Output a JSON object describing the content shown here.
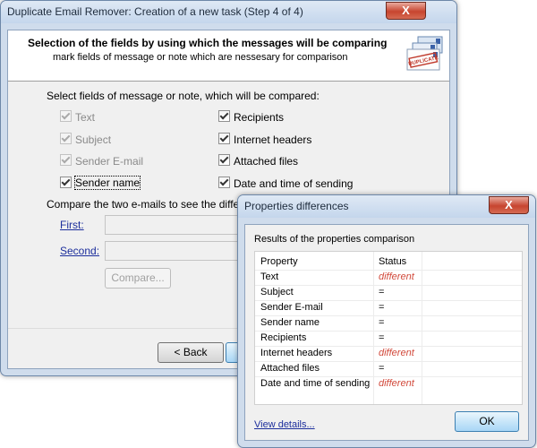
{
  "main_window": {
    "title": "Duplicate Email Remover: Creation of a new task (Step 4 of 4)",
    "close_glyph": "X",
    "header": {
      "title": "Selection of the fields by using which the messages will be comparing",
      "subtitle": "mark fields of message or note which are nessesary for comparison",
      "logo_text": "DUPLICATE",
      "logo_icon": "duplicate-envelopes-icon"
    },
    "fields_caption": "Select fields of message or note, which will be compared:",
    "fields_left": [
      {
        "label": "Text",
        "checked": true,
        "enabled": false
      },
      {
        "label": "Subject",
        "checked": true,
        "enabled": false
      },
      {
        "label": "Sender E-mail",
        "checked": true,
        "enabled": false
      },
      {
        "label": "Sender name",
        "checked": true,
        "enabled": true
      }
    ],
    "fields_right": [
      {
        "label": "Recipients",
        "checked": true,
        "enabled": true
      },
      {
        "label": "Internet headers",
        "checked": true,
        "enabled": true
      },
      {
        "label": "Attached files",
        "checked": true,
        "enabled": true
      },
      {
        "label": "Date and time of sending",
        "checked": true,
        "enabled": true
      }
    ],
    "compare_caption": "Compare the two e-mails to see the differences:",
    "first_link": "First:",
    "second_link": "Second:",
    "compare_button": "Compare...",
    "back_button": "< Back"
  },
  "dialog": {
    "title": "Properties differences",
    "close_glyph": "X",
    "results_caption": "Results of the properties comparison",
    "columns": [
      "Property",
      "Status"
    ],
    "rows": [
      {
        "property": "Text",
        "status": "different",
        "differs": true
      },
      {
        "property": "Subject",
        "status": "=",
        "differs": false
      },
      {
        "property": "Sender E-mail",
        "status": "=",
        "differs": false
      },
      {
        "property": "Sender name",
        "status": "=",
        "differs": false
      },
      {
        "property": "Recipients",
        "status": "=",
        "differs": false
      },
      {
        "property": "Internet headers",
        "status": "different",
        "differs": true
      },
      {
        "property": "Attached files",
        "status": "=",
        "differs": false
      },
      {
        "property": "Date and time of sending",
        "status": "different",
        "differs": true
      }
    ],
    "view_details_link": "View details...",
    "ok_button": "OK"
  },
  "colors": {
    "different_status": "#d24a3c",
    "link": "#1c2e9c",
    "title_bar": "#c4d6ec",
    "close_button": "#c7452f"
  }
}
